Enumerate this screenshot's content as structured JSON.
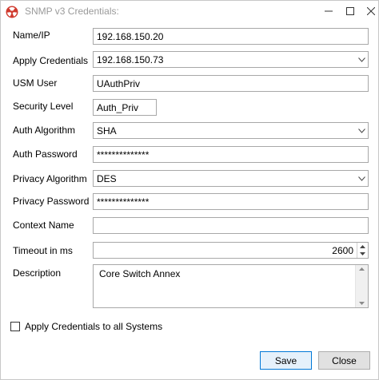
{
  "window": {
    "title": "SNMP v3 Credentials:",
    "app_icon": "radiation-icon",
    "minimize_glyph": "—",
    "maximize_glyph": "☐",
    "close_glyph": "✕"
  },
  "form": {
    "name_ip": {
      "label": "Name/IP",
      "value": "192.168.150.20"
    },
    "apply_credentials": {
      "label": "Apply Credentials",
      "value": "192.168.150.73"
    },
    "usm_user": {
      "label": "USM User",
      "value": "UAuthPriv"
    },
    "security_level": {
      "label": "Security Level",
      "value": "Auth_Priv"
    },
    "auth_algorithm": {
      "label": "Auth Algorithm",
      "value": "SHA"
    },
    "auth_password": {
      "label": "Auth Password",
      "value": "**************"
    },
    "privacy_algorithm": {
      "label": "Privacy Algorithm",
      "value": "DES"
    },
    "privacy_password": {
      "label": "Privacy Password",
      "value": "**************"
    },
    "context_name": {
      "label": "Context Name",
      "value": ""
    },
    "timeout": {
      "label": "Timeout in ms",
      "value": "2600"
    },
    "description": {
      "label": "Description",
      "value": "Core Switch Annex"
    }
  },
  "apply_all": {
    "label": "Apply Credentials to all Systems",
    "checked": false
  },
  "buttons": {
    "save": "Save",
    "close": "Close"
  },
  "colors": {
    "accent": "#0078d7",
    "icon_red": "#d03a2e"
  }
}
